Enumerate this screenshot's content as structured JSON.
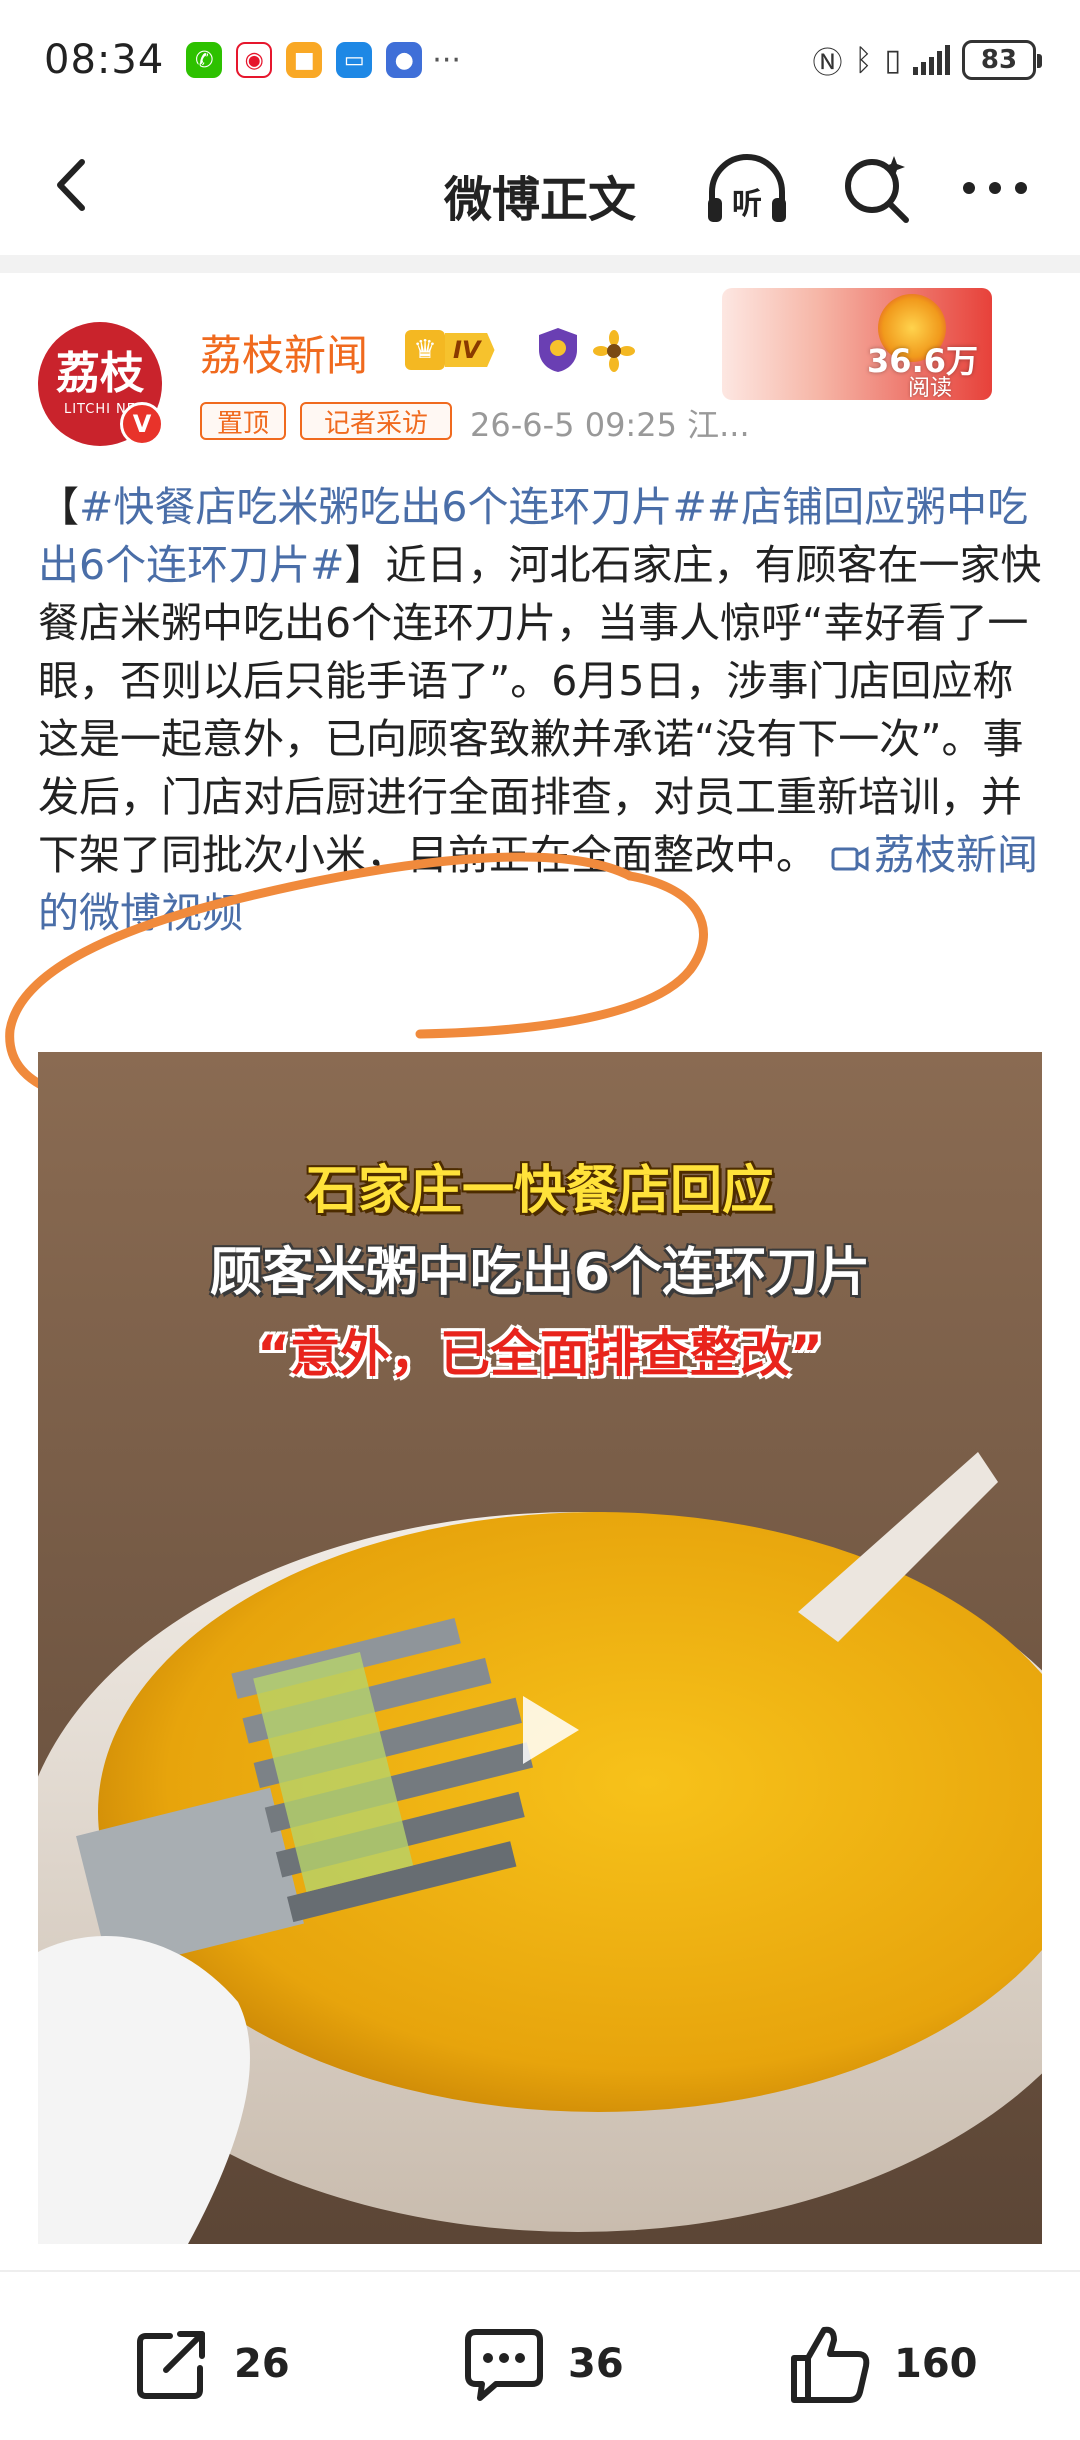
{
  "status_bar": {
    "time": "08:34",
    "battery": "83",
    "more": "···",
    "apps": [
      "wechat-icon",
      "weibo-icon",
      "app-orange-icon",
      "message-icon",
      "app-blue-icon"
    ]
  },
  "nav": {
    "title": "微博正文",
    "listen_label": "听"
  },
  "post": {
    "author": "荔枝新闻",
    "avatar_text": "荔枝",
    "avatar_sub": "LITCHI NE",
    "level": "IV",
    "tags": [
      "置顶",
      "记者采访"
    ],
    "meta": "26-6-5 09:25  江...",
    "read_count": "36.6万",
    "read_label": "阅读",
    "text": {
      "open": "【",
      "topic1": "#快餐店吃米粥吃出6个连环刀片#",
      "topic2": "#店铺回应粥中吃出6个连环刀片#",
      "body": "】近日，河北石家庄，有顾客在一家快餐店米粥中吃出6个连环刀片，当事人惊呼“幸好看了一眼，否则以后只能手语了”。6月5日，涉事门店回应称这是一起意外，已向顾客致歉并承诺“没有下一次”。事发后，门店对后厨进行全面排查，对员工重新培训，并下架了同批次小米，目前正在全面整改中。 ",
      "video_link": "荔枝新闻的微博视频"
    },
    "video": {
      "caption1": "石家庄一快餐店回应",
      "caption2": "顾客米粥中吃出6个连环刀片",
      "caption3": "“意外，已全面排查整改”"
    }
  },
  "actions": {
    "forward_count": "26",
    "comment_count": "36",
    "like_count": "160"
  },
  "colors": {
    "author": "#f06a1e",
    "topic_link": "#4a6ea8",
    "annotation": "#f08a3c"
  }
}
